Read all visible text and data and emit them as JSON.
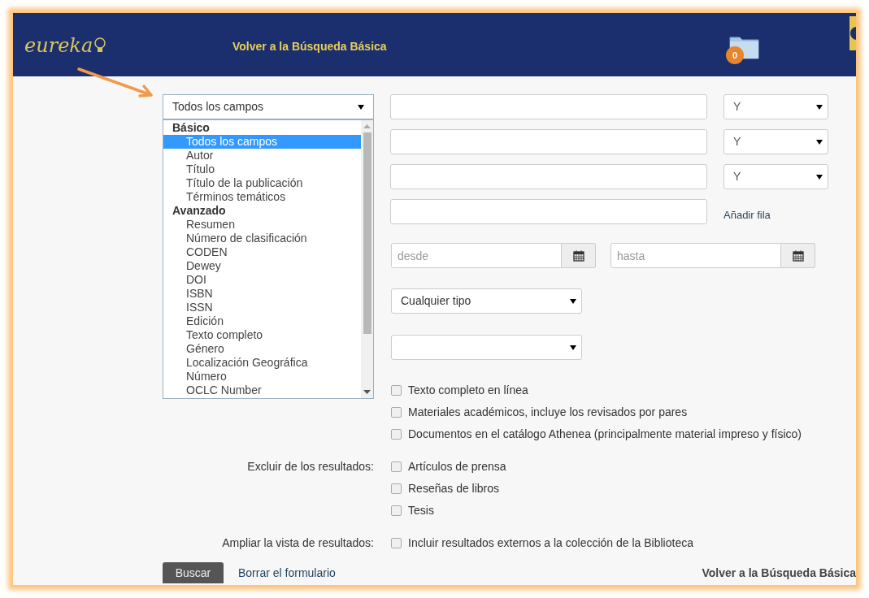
{
  "header": {
    "logo": "eureka",
    "back_link": "Volver a la Búsqueda Básica",
    "folder_count": "0"
  },
  "field_select": {
    "value": "Todos los campos",
    "groups": [
      {
        "label": "Básico",
        "options": [
          {
            "label": "Todos los campos",
            "selected": true
          },
          {
            "label": "Autor",
            "selected": false
          },
          {
            "label": "Título",
            "selected": false
          },
          {
            "label": "Título de la publicación",
            "selected": false
          },
          {
            "label": "Términos temáticos",
            "selected": false
          }
        ]
      },
      {
        "label": "Avanzado",
        "options": [
          {
            "label": "Resumen",
            "selected": false
          },
          {
            "label": "Número de clasificación",
            "selected": false
          },
          {
            "label": "CODEN",
            "selected": false
          },
          {
            "label": "Dewey",
            "selected": false
          },
          {
            "label": "DOI",
            "selected": false
          },
          {
            "label": "ISBN",
            "selected": false
          },
          {
            "label": "ISSN",
            "selected": false
          },
          {
            "label": "Edición",
            "selected": false
          },
          {
            "label": "Texto completo",
            "selected": false
          },
          {
            "label": "Género",
            "selected": false
          },
          {
            "label": "Localización Geográfica",
            "selected": false
          },
          {
            "label": "Número",
            "selected": false
          },
          {
            "label": "OCLC Number",
            "selected": false
          }
        ]
      }
    ]
  },
  "search_rows": [
    {
      "kind": "operator",
      "operator": "Y"
    },
    {
      "kind": "operator",
      "operator": "Y"
    },
    {
      "kind": "operator",
      "operator": "Y"
    },
    {
      "kind": "add",
      "add_link": "Añadir fila"
    }
  ],
  "date_range": {
    "from_placeholder": "desde",
    "to_placeholder": "hasta"
  },
  "type_select": {
    "value": "Cualquier tipo"
  },
  "filters": [
    {
      "options": [
        {
          "label": "Texto completo en línea",
          "checked": false
        },
        {
          "label": "Materiales académicos, incluye los revisados por pares",
          "checked": false
        },
        {
          "label": "Documentos en el catálogo Athenea (principalmente material impreso y físico)",
          "checked": false
        }
      ]
    },
    {
      "label": "Excluir de los resultados:",
      "options": [
        {
          "label": "Artículos de prensa",
          "checked": false
        },
        {
          "label": "Reseñas de libros",
          "checked": false
        },
        {
          "label": "Tesis",
          "checked": false
        }
      ]
    },
    {
      "label": "Ampliar la vista de resultados:",
      "options": [
        {
          "label": "Incluir resultados externos a la colección de la Biblioteca",
          "checked": false
        }
      ]
    }
  ],
  "actions": {
    "search_button": "Buscar",
    "clear_link": "Borrar el formulario",
    "back_link": "Volver a la Búsqueda Básica"
  }
}
